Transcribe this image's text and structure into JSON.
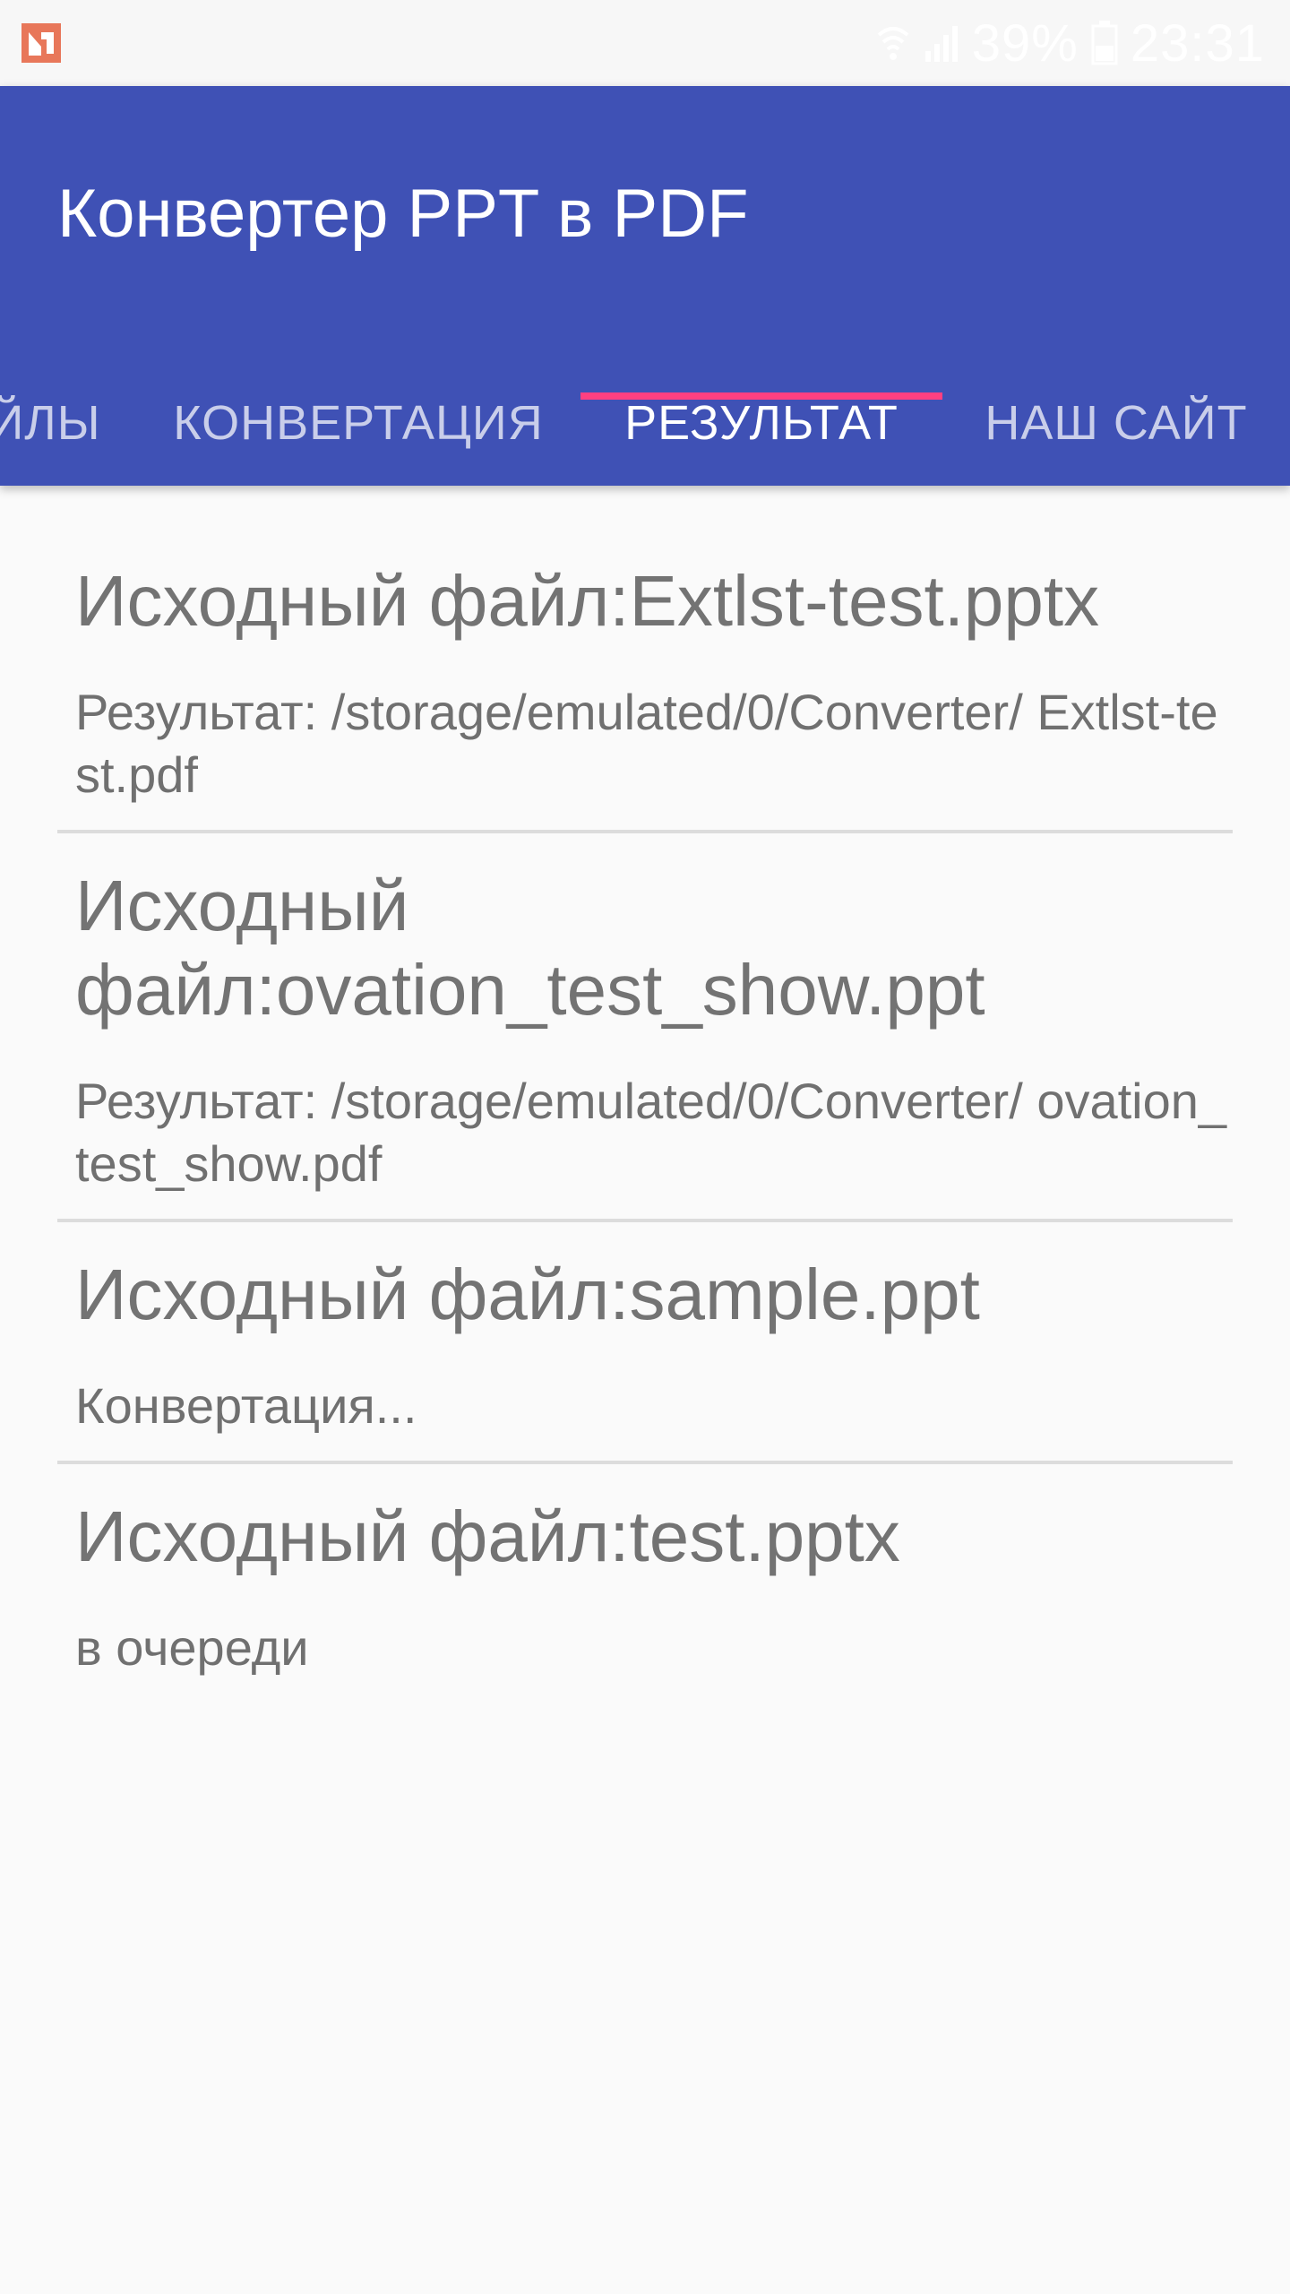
{
  "status_bar": {
    "battery": "39%",
    "time": "23:31"
  },
  "app": {
    "title": "Конвертер PPT в PDF",
    "accent_color": "#3f51b5",
    "indicator_color": "#ff4081"
  },
  "tabs": [
    {
      "label": "ЙЛЫ",
      "active": false
    },
    {
      "label": "КОНВЕРТАЦИЯ",
      "active": false
    },
    {
      "label": "РЕЗУЛЬТАТ",
      "active": true
    },
    {
      "label": "НАШ САЙТ",
      "active": false
    }
  ],
  "results": [
    {
      "title": "Исходный файл:Extlst-test.pptx",
      "status": "Результат: /storage/emulated/0/Converter/ Extlst-test.pdf"
    },
    {
      "title": "Исходный файл:ovation_test_show.ppt",
      "status": "Результат: /storage/emulated/0/Converter/ ovation_test_show.pdf"
    },
    {
      "title": "Исходный файл:sample.ppt",
      "status": "Конвертация..."
    },
    {
      "title": "Исходный файл:test.pptx",
      "status": "в очереди"
    }
  ]
}
